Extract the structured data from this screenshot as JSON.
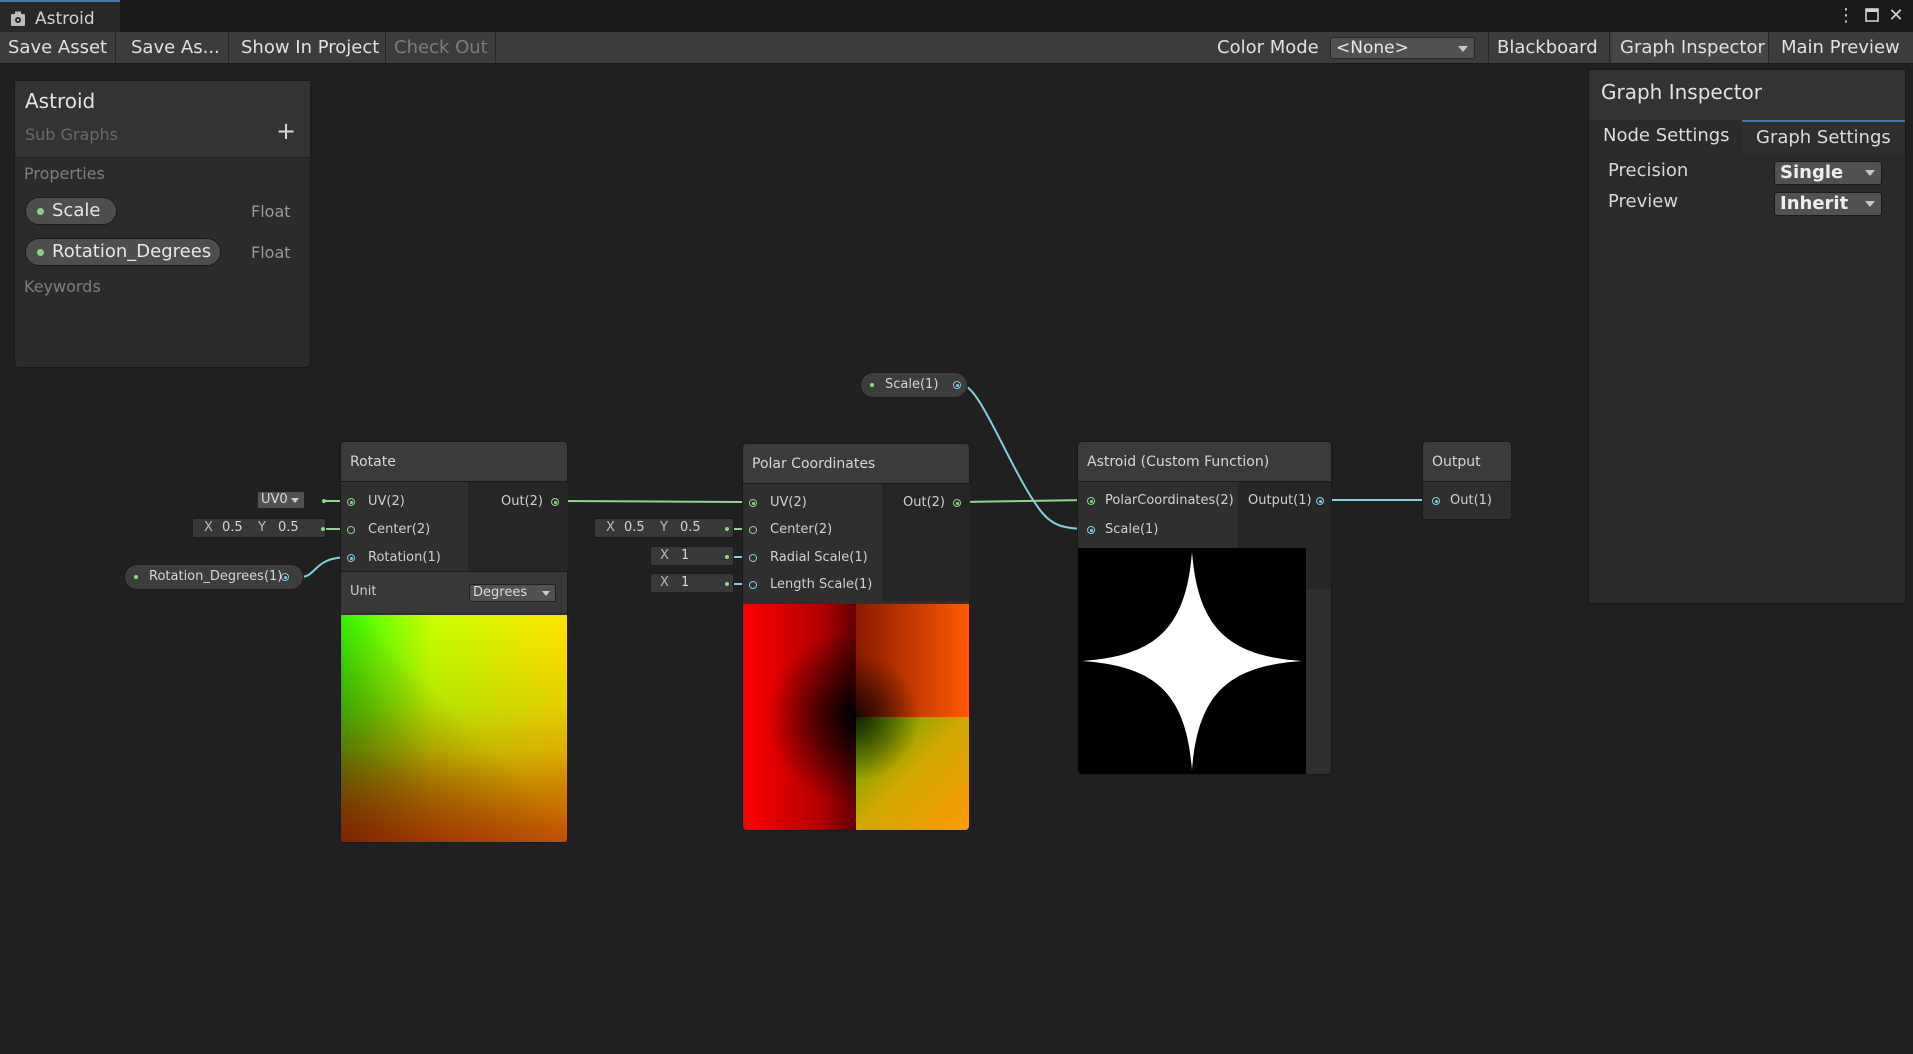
{
  "window": {
    "tab_title": "Astroid",
    "controls": [
      "more-options",
      "maximize",
      "close"
    ]
  },
  "toolbar": {
    "save_asset": "Save Asset",
    "save_as": "Save As...",
    "show_in_project": "Show In Project",
    "check_out": "Check Out",
    "color_mode_label": "Color Mode",
    "color_mode_value": "<None>",
    "blackboard": "Blackboard",
    "graph_inspector": "Graph Inspector",
    "main_preview": "Main Preview"
  },
  "blackboard": {
    "title": "Astroid",
    "subtitle": "Sub Graphs",
    "add_symbol": "+",
    "properties_label": "Properties",
    "properties": [
      {
        "name": "Scale",
        "type": "Float"
      },
      {
        "name": "Rotation_Degrees",
        "type": "Float"
      }
    ],
    "keywords_label": "Keywords"
  },
  "inspector": {
    "title": "Graph Inspector",
    "tabs": [
      "Node Settings",
      "Graph Settings"
    ],
    "active_tab": "Graph Settings",
    "settings": [
      {
        "label": "Precision",
        "value": "Single"
      },
      {
        "label": "Preview",
        "value": "Inherit"
      }
    ]
  },
  "nodes": {
    "rotate": {
      "title": "Rotate",
      "inputs": [
        "UV(2)",
        "Center(2)",
        "Rotation(1)"
      ],
      "output": "Out(2)",
      "uv_default": "UV0",
      "center_x_label": "X",
      "center_x": "0.5",
      "center_y_label": "Y",
      "center_y": "0.5",
      "unit_label": "Unit",
      "unit_value": "Degrees"
    },
    "polar": {
      "title": "Polar Coordinates",
      "inputs": [
        "UV(2)",
        "Center(2)",
        "Radial Scale(1)",
        "Length Scale(1)"
      ],
      "output": "Out(2)",
      "center_x_label": "X",
      "center_x": "0.5",
      "center_y_label": "Y",
      "center_y": "0.5",
      "radial_x_label": "X",
      "radial_x": "1",
      "length_x_label": "X",
      "length_x": "1"
    },
    "astroid": {
      "title": "Astroid (Custom Function)",
      "inputs": [
        "PolarCoordinates(2)",
        "Scale(1)"
      ],
      "output": "Output(1)"
    },
    "output": {
      "title": "Output",
      "input": "Out(1)"
    },
    "prop_scale": "Scale(1)",
    "prop_rotation": "Rotation_Degrees(1)"
  },
  "colors": {
    "background": "#202020",
    "vector_wire": "#90d48a",
    "float_wire": "#84cfe0",
    "accent_tab": "#3a79bb"
  }
}
